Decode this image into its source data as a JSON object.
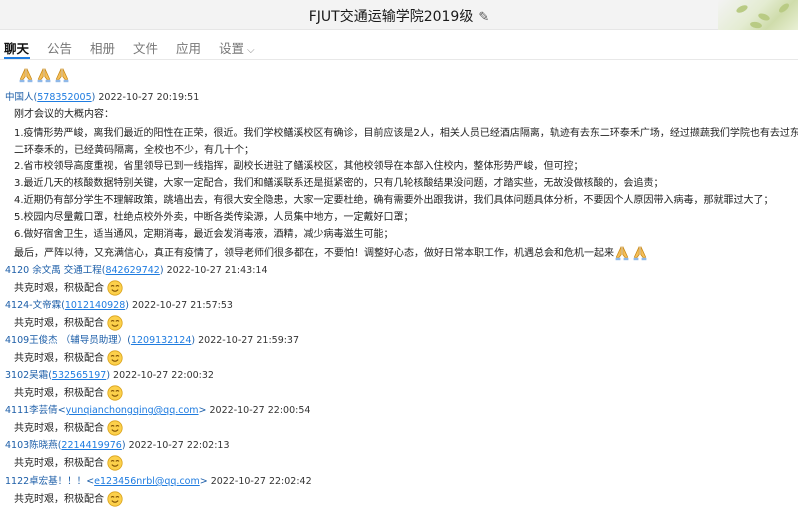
{
  "window": {
    "title": "FJUT交通运输学院2019级",
    "edit_icon": "✎"
  },
  "tabs": [
    "聊天",
    "公告",
    "相册",
    "文件",
    "应用",
    "设置"
  ],
  "emoji_icons": {
    "pray": "pray-hands-icon",
    "smile": "smile-face-icon"
  },
  "first_post": {
    "sender": "中国人",
    "qq": "578352005",
    "timestamp": "2022-10-27 20:19:51",
    "lines": [
      "刚才会议的大概内容：",
      "1.疫情形势严峻，离我们最近的阳性在正荣，很近。我们学校鳝溪校区有确诊，目前应该是2人，相关人员已经酒店隔离，轨迹有去东二环泰禾广场，经过撷蔬我们学院也有去过东",
      "二环泰禾的，已经黄码隔离，全校也不少，有几十个；",
      "2.省市校领导高度重视，省里领导已到一线指挥，副校长进驻了鳝溪校区，其他校领导在本部入住校内，整体形势严峻，但可控；",
      "3.最近几天的核酸数据特别关键，大家一定配合，我们和鳝溪联系还是挺紧密的，只有几轮核酸结果没问题，才踏实些，无故没做核酸的，会追责；",
      "4.近期仍有部分学生不理解政策，跳墙出去，有很大安全隐患，大家一定要杜绝，确有需要外出跟我讲，我们具体问题具体分析，不要因个人原因带入病毒，那就罪过大了；",
      "5.校园内尽量戴口罩，杜绝点校外外卖，中断各类传染源，人员集中地方，一定戴好口罩；",
      "6.做好宿舍卫生，适当通风，定期消毒，最近会发消毒液，酒精，减少病毒滋生可能；",
      "最后，严阵以待，又充满信心，真正有疫情了，领导老师们很多都在，不要怕！调整好心态，做好日常本职工作，机遇总会和危机一起来"
    ]
  },
  "replies": [
    {
      "sender": "4120 余文禹",
      "extra": "交通工程",
      "qq": "842629742",
      "qq_wrap": "()",
      "timestamp": "2022-10-27 21:43:14",
      "text": "共克时艰，积极配合"
    },
    {
      "sender": "4124-文帝霖",
      "extra": "",
      "qq": "1012140928",
      "qq_wrap": "()",
      "timestamp": "2022-10-27 21:57:53",
      "text": "共克时艰，积极配合"
    },
    {
      "sender": "4109王俊杰",
      "extra": "（辅导员助理）",
      "qq": "1209132124",
      "qq_wrap": "()",
      "timestamp": "2022-10-27 21:59:37",
      "text": "共克时艰，积极配合"
    },
    {
      "sender": "3102吴霜",
      "extra": "",
      "qq": "532565197",
      "qq_wrap": "()",
      "timestamp": "2022-10-27 22:00:32",
      "text": "共克时艰，积极配合"
    },
    {
      "sender": "4111李芸倩",
      "extra": "",
      "qq": "yunqianchongqing@qq.com",
      "qq_wrap": "<>",
      "timestamp": "2022-10-27 22:00:54",
      "text": "共克时艰，积极配合"
    },
    {
      "sender": "4103陈晓燕",
      "extra": "",
      "qq": "2214419976",
      "qq_wrap": "()",
      "timestamp": "2022-10-27 22:02:13",
      "text": "共克时艰，积极配合"
    },
    {
      "sender": "1122卓宏基！！！",
      "extra": "",
      "qq": "e123456nrbl@qq.com",
      "qq_wrap": "<>",
      "timestamp": "2022-10-27 22:02:42",
      "text": "共克时艰，积极配合"
    }
  ]
}
